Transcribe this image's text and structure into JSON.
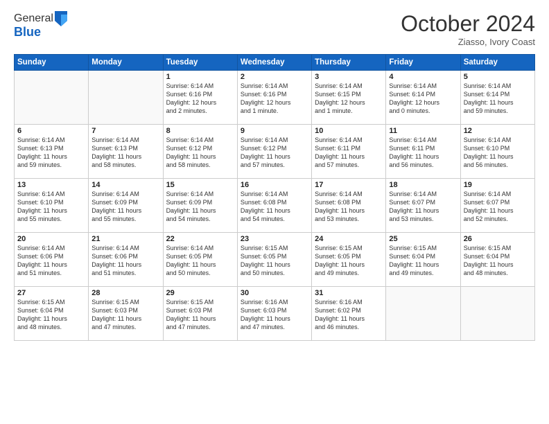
{
  "logo": {
    "general": "General",
    "blue": "Blue"
  },
  "title": "October 2024",
  "subtitle": "Ziasso, Ivory Coast",
  "days_of_week": [
    "Sunday",
    "Monday",
    "Tuesday",
    "Wednesday",
    "Thursday",
    "Friday",
    "Saturday"
  ],
  "weeks": [
    [
      {
        "day": "",
        "empty": true
      },
      {
        "day": "",
        "empty": true
      },
      {
        "day": "1",
        "info": "Sunrise: 6:14 AM\nSunset: 6:16 PM\nDaylight: 12 hours\nand 2 minutes."
      },
      {
        "day": "2",
        "info": "Sunrise: 6:14 AM\nSunset: 6:16 PM\nDaylight: 12 hours\nand 1 minute."
      },
      {
        "day": "3",
        "info": "Sunrise: 6:14 AM\nSunset: 6:15 PM\nDaylight: 12 hours\nand 1 minute."
      },
      {
        "day": "4",
        "info": "Sunrise: 6:14 AM\nSunset: 6:14 PM\nDaylight: 12 hours\nand 0 minutes."
      },
      {
        "day": "5",
        "info": "Sunrise: 6:14 AM\nSunset: 6:14 PM\nDaylight: 11 hours\nand 59 minutes."
      }
    ],
    [
      {
        "day": "6",
        "info": "Sunrise: 6:14 AM\nSunset: 6:13 PM\nDaylight: 11 hours\nand 59 minutes."
      },
      {
        "day": "7",
        "info": "Sunrise: 6:14 AM\nSunset: 6:13 PM\nDaylight: 11 hours\nand 58 minutes."
      },
      {
        "day": "8",
        "info": "Sunrise: 6:14 AM\nSunset: 6:12 PM\nDaylight: 11 hours\nand 58 minutes."
      },
      {
        "day": "9",
        "info": "Sunrise: 6:14 AM\nSunset: 6:12 PM\nDaylight: 11 hours\nand 57 minutes."
      },
      {
        "day": "10",
        "info": "Sunrise: 6:14 AM\nSunset: 6:11 PM\nDaylight: 11 hours\nand 57 minutes."
      },
      {
        "day": "11",
        "info": "Sunrise: 6:14 AM\nSunset: 6:11 PM\nDaylight: 11 hours\nand 56 minutes."
      },
      {
        "day": "12",
        "info": "Sunrise: 6:14 AM\nSunset: 6:10 PM\nDaylight: 11 hours\nand 56 minutes."
      }
    ],
    [
      {
        "day": "13",
        "info": "Sunrise: 6:14 AM\nSunset: 6:10 PM\nDaylight: 11 hours\nand 55 minutes."
      },
      {
        "day": "14",
        "info": "Sunrise: 6:14 AM\nSunset: 6:09 PM\nDaylight: 11 hours\nand 55 minutes."
      },
      {
        "day": "15",
        "info": "Sunrise: 6:14 AM\nSunset: 6:09 PM\nDaylight: 11 hours\nand 54 minutes."
      },
      {
        "day": "16",
        "info": "Sunrise: 6:14 AM\nSunset: 6:08 PM\nDaylight: 11 hours\nand 54 minutes."
      },
      {
        "day": "17",
        "info": "Sunrise: 6:14 AM\nSunset: 6:08 PM\nDaylight: 11 hours\nand 53 minutes."
      },
      {
        "day": "18",
        "info": "Sunrise: 6:14 AM\nSunset: 6:07 PM\nDaylight: 11 hours\nand 53 minutes."
      },
      {
        "day": "19",
        "info": "Sunrise: 6:14 AM\nSunset: 6:07 PM\nDaylight: 11 hours\nand 52 minutes."
      }
    ],
    [
      {
        "day": "20",
        "info": "Sunrise: 6:14 AM\nSunset: 6:06 PM\nDaylight: 11 hours\nand 51 minutes."
      },
      {
        "day": "21",
        "info": "Sunrise: 6:14 AM\nSunset: 6:06 PM\nDaylight: 11 hours\nand 51 minutes."
      },
      {
        "day": "22",
        "info": "Sunrise: 6:14 AM\nSunset: 6:05 PM\nDaylight: 11 hours\nand 50 minutes."
      },
      {
        "day": "23",
        "info": "Sunrise: 6:15 AM\nSunset: 6:05 PM\nDaylight: 11 hours\nand 50 minutes."
      },
      {
        "day": "24",
        "info": "Sunrise: 6:15 AM\nSunset: 6:05 PM\nDaylight: 11 hours\nand 49 minutes."
      },
      {
        "day": "25",
        "info": "Sunrise: 6:15 AM\nSunset: 6:04 PM\nDaylight: 11 hours\nand 49 minutes."
      },
      {
        "day": "26",
        "info": "Sunrise: 6:15 AM\nSunset: 6:04 PM\nDaylight: 11 hours\nand 48 minutes."
      }
    ],
    [
      {
        "day": "27",
        "info": "Sunrise: 6:15 AM\nSunset: 6:04 PM\nDaylight: 11 hours\nand 48 minutes."
      },
      {
        "day": "28",
        "info": "Sunrise: 6:15 AM\nSunset: 6:03 PM\nDaylight: 11 hours\nand 47 minutes."
      },
      {
        "day": "29",
        "info": "Sunrise: 6:15 AM\nSunset: 6:03 PM\nDaylight: 11 hours\nand 47 minutes."
      },
      {
        "day": "30",
        "info": "Sunrise: 6:16 AM\nSunset: 6:03 PM\nDaylight: 11 hours\nand 47 minutes."
      },
      {
        "day": "31",
        "info": "Sunrise: 6:16 AM\nSunset: 6:02 PM\nDaylight: 11 hours\nand 46 minutes."
      },
      {
        "day": "",
        "empty": true
      },
      {
        "day": "",
        "empty": true
      }
    ]
  ]
}
